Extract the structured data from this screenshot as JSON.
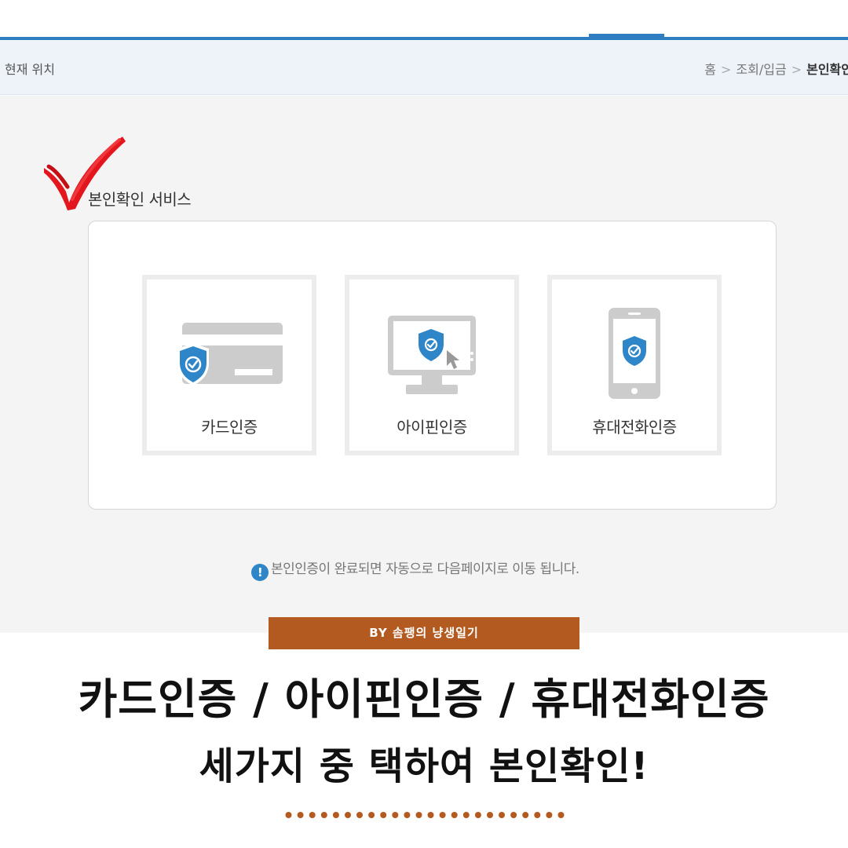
{
  "breadcrumb": {
    "location_label": "현재 위치",
    "items": [
      "홈",
      "조회/입금",
      "본인확인"
    ],
    "separator": ">"
  },
  "section": {
    "title": "본인확인 서비스"
  },
  "auth_options": [
    {
      "label": "카드인증",
      "icon": "credit-card-shield-icon"
    },
    {
      "label": "아이핀인증",
      "icon": "monitor-shield-icon"
    },
    {
      "label": "휴대전화인증",
      "icon": "smartphone-shield-icon"
    }
  ],
  "notice": {
    "icon": "!",
    "text": "본인인증이 완료되면 자동으로 다음페이지로 이동 됩니다."
  },
  "caption": {
    "byline": "BY 솜팽의 냥생일기",
    "headline_line1": "카드인증 / 아이핀인증 / 휴대전화인증",
    "headline_line2": "세가지 중 택하여 본인확인!"
  },
  "colors": {
    "accent_blue": "#2f7ec1",
    "shield_blue": "#2e86c9",
    "byline_brown": "#b35a20",
    "check_red": "#e3161d"
  }
}
